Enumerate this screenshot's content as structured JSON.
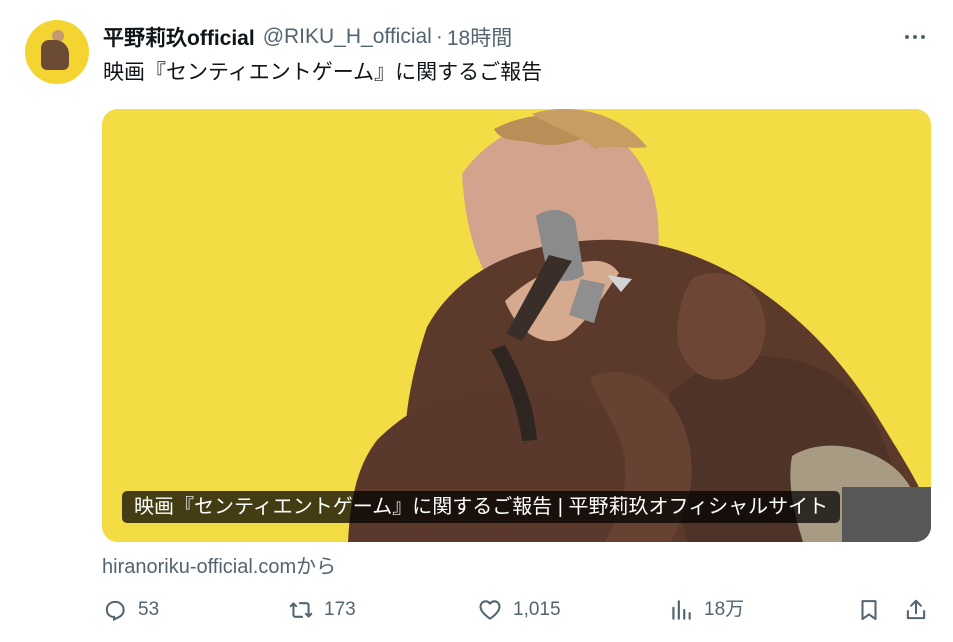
{
  "tweet": {
    "display_name": "平野莉玖official",
    "handle": "@RIKU_H_official",
    "separator": "·",
    "time": "18時間",
    "text": "映画『センティエントゲーム』に関するご報告",
    "more_icon": "more-horizontal-icon"
  },
  "card": {
    "title": "映画『センティエントゲーム』に関するご報告 | 平野莉玖オフィシャルサイト",
    "domain_label": "hiranoriku-official.comから"
  },
  "actions": {
    "reply": {
      "icon": "reply-icon",
      "count": "53"
    },
    "retweet": {
      "icon": "retweet-icon",
      "count": "173"
    },
    "like": {
      "icon": "heart-icon",
      "count": "1,015"
    },
    "views": {
      "icon": "analytics-icon",
      "count": "18万"
    },
    "bookmark": {
      "icon": "bookmark-icon"
    },
    "share": {
      "icon": "share-icon"
    }
  },
  "colors": {
    "text": "#0f1419",
    "secondary": "#536471",
    "card_background": "#f4dc44",
    "jacket": "#5b3a2c"
  }
}
